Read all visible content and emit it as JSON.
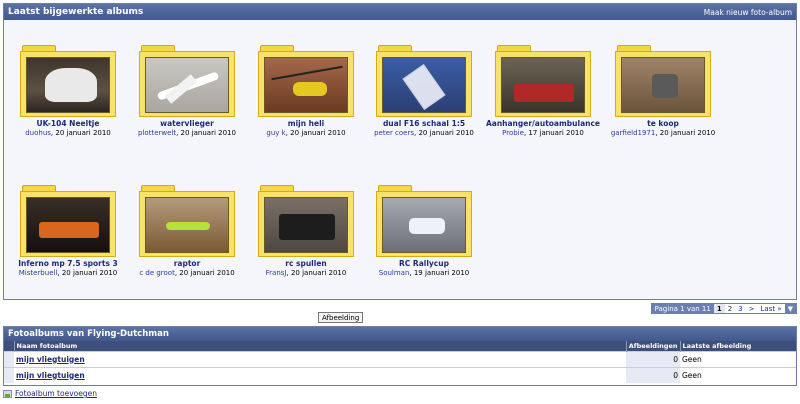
{
  "panel": {
    "title": "Laatst bijgewerkte albums",
    "new_album_link": "Maak nieuw foto-album"
  },
  "albums": [
    {
      "title": "UK-104 Neeltje",
      "user": "duohus",
      "date": ", 20 januari 2010"
    },
    {
      "title": "watervlieger",
      "user": "plotterwelt",
      "date": ", 20 januari 2010"
    },
    {
      "title": "mijn heli",
      "user": "guy k",
      "date": ", 20 januari 2010"
    },
    {
      "title": "dual F16 schaal 1:5",
      "user": "peter coers",
      "date": ", 20 januari 2010"
    },
    {
      "title": "Aanhanger/autoambulance",
      "user": "Probie",
      "date": ", 17 januari 2010"
    },
    {
      "title": "te koop",
      "user": "garfield1971",
      "date": ", 20 januari 2010"
    },
    {
      "title": "Inferno mp 7.5 sports 3",
      "user": "Misterbuell",
      "date": ", 20 januari 2010"
    },
    {
      "title": "raptor",
      "user": "c de groot",
      "date": ", 20 januari 2010"
    },
    {
      "title": "rc spullen",
      "user": "FransJ",
      "date": ", 20 januari 2010"
    },
    {
      "title": "RC Rallycup",
      "user": "Soulman",
      "date": ", 19 januari 2010"
    }
  ],
  "pager": {
    "label": "Pagina 1 van 11",
    "current": "1",
    "page2": "2",
    "page3": "3",
    "next": ">",
    "last": "Last »",
    "dropdown": "▼"
  },
  "tooltip": "Afbeelding",
  "section": {
    "title": "Fotoalbums van Flying-Dutchman",
    "columns": {
      "name": "Naam fotoalbum",
      "count": "Afbeeldingen",
      "last": "Laatste afbeelding"
    },
    "rows": [
      {
        "name": "mijn vliegtuigen",
        "count": "0",
        "last": "Geen"
      },
      {
        "name": "mijn vliegtuigen",
        "count": "0",
        "last": "Geen"
      }
    ]
  },
  "add_album": "Fotoalbum toevoegen"
}
